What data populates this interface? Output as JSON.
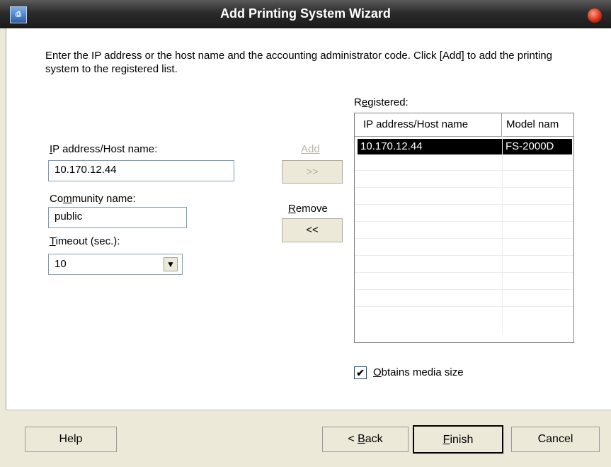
{
  "window": {
    "title": "Add Printing System Wizard"
  },
  "instruction": "Enter the IP address or the host name and the accounting administrator code. Click [Add] to add the printing system to the registered list.",
  "fields": {
    "ip_label_key": "I",
    "ip_label_rest": "P address/Host name:",
    "ip_value": "10.170.12.44",
    "community_label_pre": "Co",
    "community_label_key": "m",
    "community_label_rest": "munity name:",
    "community_value": "public",
    "timeout_label_key": "T",
    "timeout_label_rest": "imeout (sec.):",
    "timeout_value": "10"
  },
  "actions": {
    "add_label": "Add",
    "add_button": ">>",
    "remove_label_key": "R",
    "remove_label_rest": "emove",
    "remove_button": "<<"
  },
  "registered": {
    "label_pre": "R",
    "label_key": "e",
    "label_rest": "gistered:",
    "columns": [
      "IP address/Host name",
      "Model nam"
    ],
    "rows": [
      {
        "ip": "10.170.12.44",
        "model": "FS-2000D"
      }
    ]
  },
  "options": {
    "obtains_media_key": "O",
    "obtains_media_rest": "btains media size",
    "obtains_media_checked": true
  },
  "footer": {
    "help": "Help",
    "back_pre": "< ",
    "back_key": "B",
    "back_rest": "ack",
    "finish_key": "F",
    "finish_rest": "inish",
    "cancel": "Cancel"
  }
}
